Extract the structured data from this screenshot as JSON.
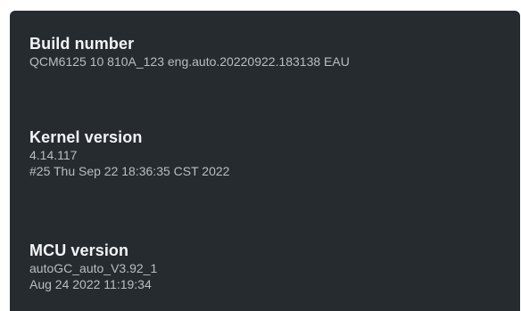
{
  "settings": {
    "build": {
      "title": "Build number",
      "lines": [
        "QCM6125 10 810A_123 eng.auto.20220922.183138 EAU"
      ]
    },
    "kernel": {
      "title": "Kernel version",
      "lines": [
        "4.14.117",
        "#25 Thu Sep 22 18:36:35 CST 2022"
      ]
    },
    "mcu": {
      "title": "MCU version",
      "lines": [
        "autoGC_auto_V3.92_1",
        "Aug 24 2022 11:19:34"
      ]
    }
  }
}
